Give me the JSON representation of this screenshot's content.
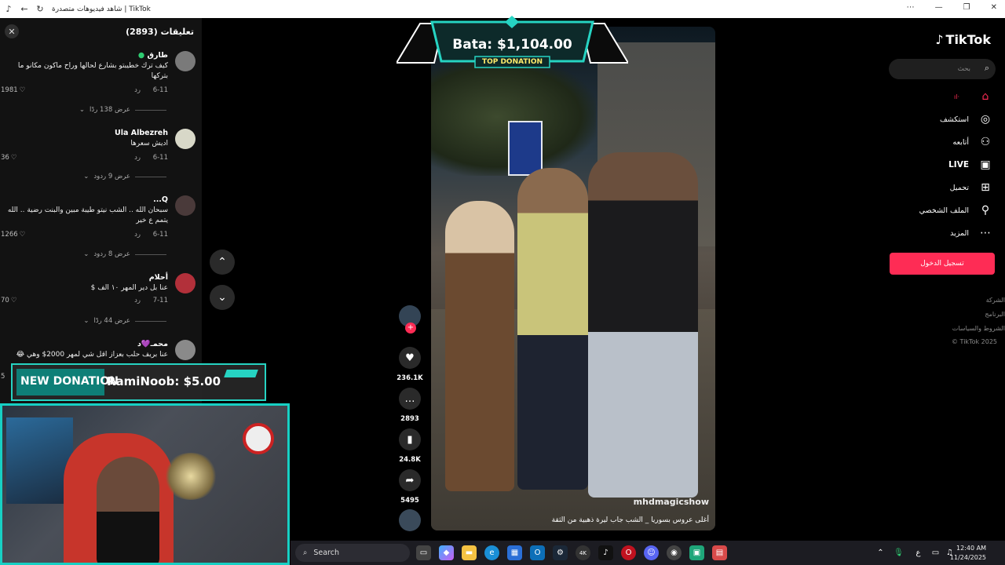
{
  "browser": {
    "title": "شاهد فيديوهات متصدرة | TikTok"
  },
  "comments": {
    "header": "تعليقات (2893)",
    "items": [
      {
        "name": "طارق",
        "text": "كيف ترك خطيبتو بشارع لحالها وراح ماكون مكانو ما بتركها",
        "date": "6-11",
        "reply": "رد",
        "likes": "1981",
        "view_replies": "عرض 138 ردًا"
      },
      {
        "name": "Ula Albezreh",
        "text": "اديش سعرها",
        "date": "6-11",
        "reply": "رد",
        "likes": "36",
        "view_replies": "عرض 9 ردود"
      },
      {
        "name": "Q...",
        "text": "سبحان الله .. الشب نيتو طيبة مبين والبنت رضية .. الله يتمم ع خير",
        "date": "6-11",
        "reply": "رد",
        "likes": "1266",
        "view_replies": "عرض 8 ردود"
      },
      {
        "name": "أحلام",
        "text": "عنا بل دير المهر ١٠ الف $",
        "date": "7-11",
        "reply": "رد",
        "likes": "70",
        "view_replies": "عرض 44 ردًا"
      },
      {
        "name": "محمـ💜د",
        "text": "عنا بريف حلب بعزاز اقل شي لمهر 2000$ وهي 😂",
        "date": "",
        "reply": "",
        "likes": "5",
        "view_replies": ""
      }
    ]
  },
  "video": {
    "watermark": "mhdmagicshow",
    "caption": "أغلى عروس بسوريا _ الشب جاب ليرة ذهبية من الثقة"
  },
  "actions": {
    "likes": "236.1K",
    "comments": "2893",
    "saves": "24.8K",
    "shares": "5495"
  },
  "sidebar": {
    "logo": "TikTok",
    "search_placeholder": "بحث",
    "nav": [
      {
        "label": "",
        "icon": "home-icon"
      },
      {
        "label": "استكشف",
        "icon": "compass-icon"
      },
      {
        "label": "أتابعه",
        "icon": "user-plus-icon"
      },
      {
        "label": "LIVE",
        "icon": "live-icon"
      },
      {
        "label": "تحميل",
        "icon": "upload-icon"
      },
      {
        "label": "الملف الشخصي",
        "icon": "user-icon"
      },
      {
        "label": "المزيد",
        "icon": "more-icon"
      }
    ],
    "login": "تسجيل الدخول",
    "footer": [
      "الشركة",
      "البرنامج",
      "الشروط والسياسات",
      "TikTok 2025 ©"
    ]
  },
  "overlays": {
    "top_donation_amount": "Bata: $1,104.00",
    "top_donation_label": "TOP DONATION",
    "new_donation_label": "NEW DONATION",
    "new_donation_text": "RamiNoob: $5.00"
  },
  "taskbar": {
    "search": "Search",
    "time": "12:40 AM",
    "date": "11/24/2025",
    "lang": "ع"
  },
  "colors": {
    "accent_pink": "#fe2c55",
    "overlay_teal": "#26d3c2"
  }
}
